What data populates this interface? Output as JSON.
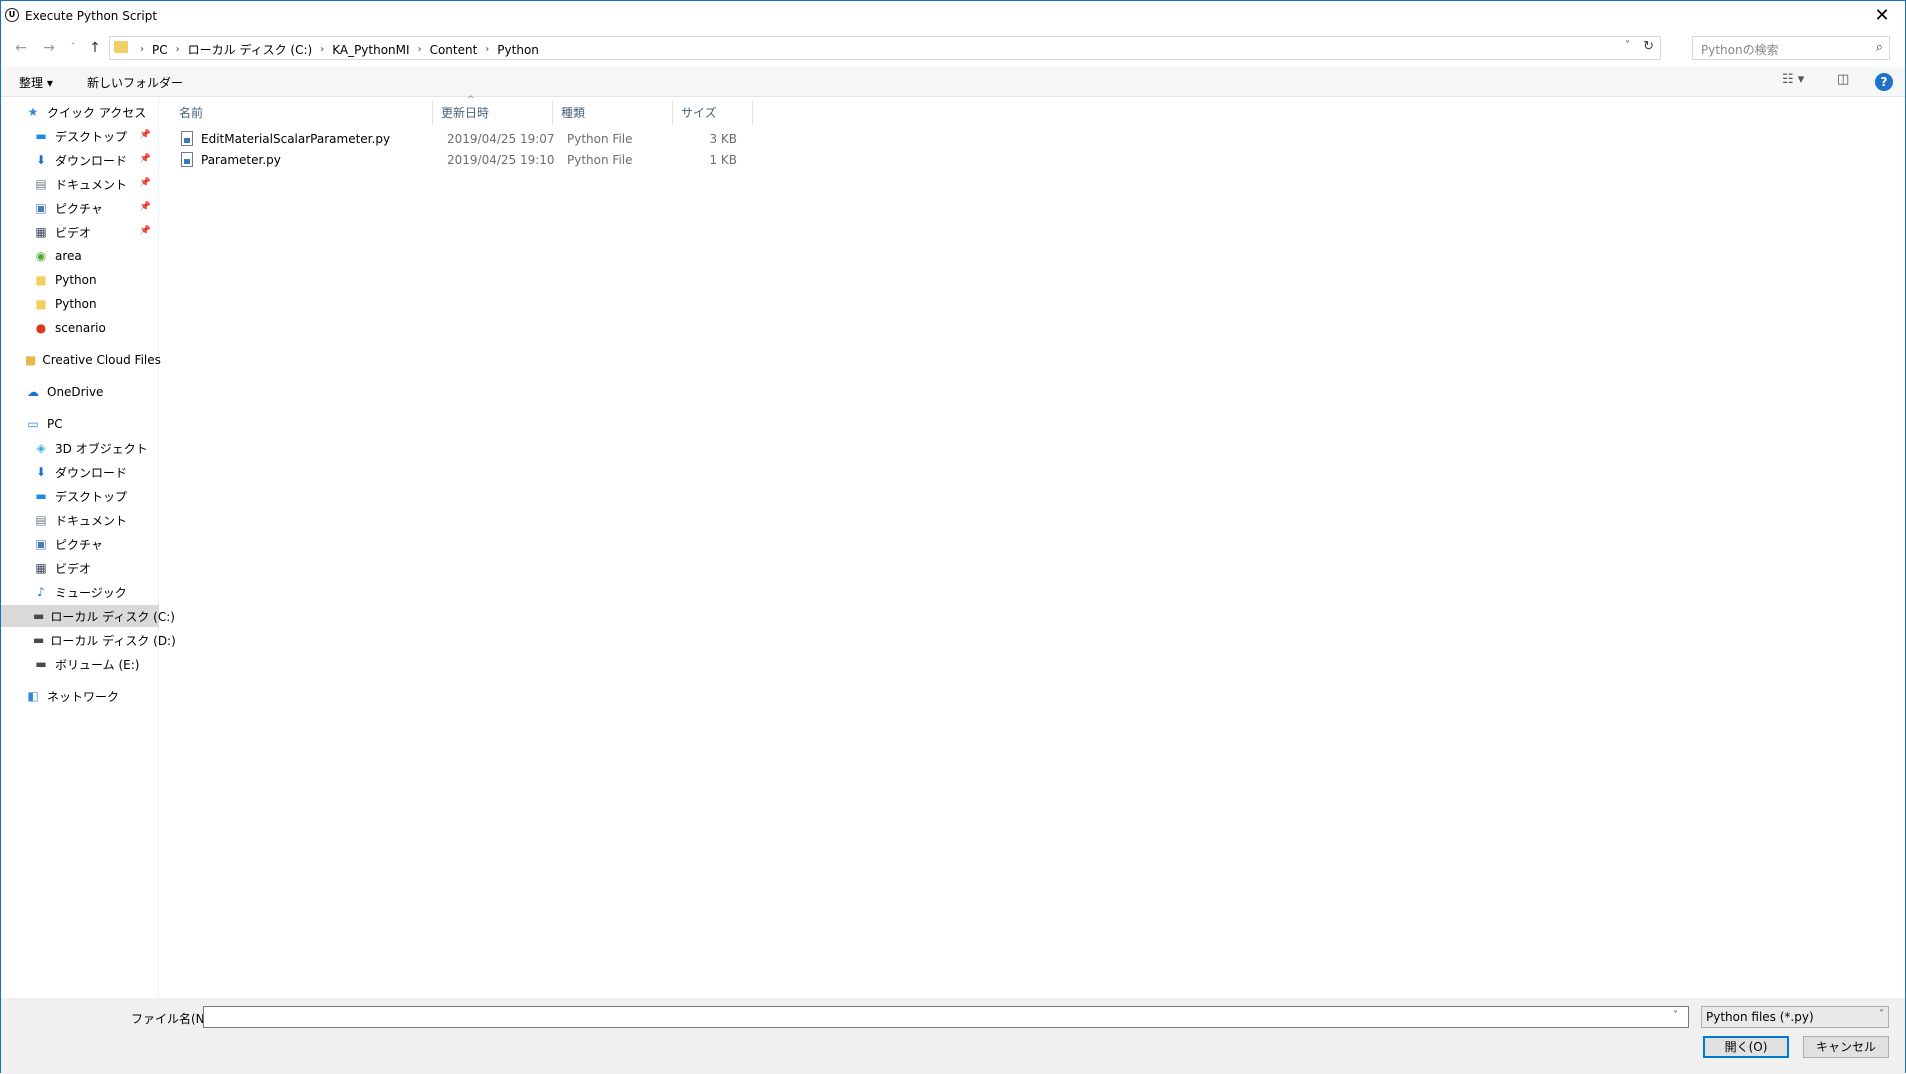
{
  "window": {
    "title": "Execute Python Script",
    "close_glyph": "✕",
    "app_icon_text": "U"
  },
  "address": {
    "crumbs": [
      "PC",
      "ローカル ディスク (C:)",
      "KA_PythonMI",
      "Content",
      "Python"
    ],
    "search_placeholder": "Pythonの検索"
  },
  "toolbar": {
    "organize": "整理 ▾",
    "new_folder": "新しいフォルダー",
    "help": "?"
  },
  "nav": {
    "items": [
      {
        "label": "クイック アクセス",
        "icon": "star-icon",
        "glyph": "★",
        "color": "#3a87d4",
        "indent": 0,
        "pinned": false,
        "top": 0
      },
      {
        "label": "デスクトップ",
        "icon": "desktop-icon",
        "glyph": "▬",
        "color": "#1e88e5",
        "indent": 1,
        "pinned": true
      },
      {
        "label": "ダウンロード",
        "icon": "download-icon",
        "glyph": "⬇",
        "color": "#1e6fc9",
        "indent": 1,
        "pinned": true
      },
      {
        "label": "ドキュメント",
        "icon": "document-icon",
        "glyph": "▤",
        "color": "#6d7b8a",
        "indent": 1,
        "pinned": true
      },
      {
        "label": "ピクチャ",
        "icon": "pictures-icon",
        "glyph": "▣",
        "color": "#4a7bb0",
        "indent": 1,
        "pinned": true
      },
      {
        "label": "ビデオ",
        "icon": "video-icon",
        "glyph": "▦",
        "color": "#3b4a5a",
        "indent": 1,
        "pinned": true
      },
      {
        "label": "area",
        "icon": "sync-folder-icon",
        "glyph": "◉",
        "color": "#5aa832",
        "indent": 1,
        "pinned": false
      },
      {
        "label": "Python",
        "icon": "folder-icon",
        "glyph": "■",
        "color": "#f2cf62",
        "indent": 1,
        "pinned": false
      },
      {
        "label": "Python",
        "icon": "folder-icon",
        "glyph": "■",
        "color": "#f2cf62",
        "indent": 1,
        "pinned": false
      },
      {
        "label": "scenario",
        "icon": "error-folder-icon",
        "glyph": "●",
        "color": "#d9381e",
        "indent": 1,
        "pinned": false
      },
      {
        "label": "Creative Cloud Files",
        "icon": "creative-cloud-icon",
        "glyph": "■",
        "color": "#e8b84a",
        "indent": 0,
        "pinned": false
      },
      {
        "label": "OneDrive",
        "icon": "onedrive-icon",
        "glyph": "☁",
        "color": "#1e73c9",
        "indent": 0,
        "pinned": false
      },
      {
        "label": "PC",
        "icon": "pc-icon",
        "glyph": "▭",
        "color": "#3a87d4",
        "indent": 0,
        "pinned": false
      },
      {
        "label": "3D オブジェクト",
        "icon": "3d-objects-icon",
        "glyph": "◈",
        "color": "#3cb0d8",
        "indent": 1,
        "pinned": false
      },
      {
        "label": "ダウンロード",
        "icon": "download-icon",
        "glyph": "⬇",
        "color": "#1e6fc9",
        "indent": 1,
        "pinned": false
      },
      {
        "label": "デスクトップ",
        "icon": "desktop-icon",
        "glyph": "▬",
        "color": "#1e88e5",
        "indent": 1,
        "pinned": false
      },
      {
        "label": "ドキュメント",
        "icon": "document-icon",
        "glyph": "▤",
        "color": "#6d7b8a",
        "indent": 1,
        "pinned": false
      },
      {
        "label": "ピクチャ",
        "icon": "pictures-icon",
        "glyph": "▣",
        "color": "#4a7bb0",
        "indent": 1,
        "pinned": false
      },
      {
        "label": "ビデオ",
        "icon": "video-icon",
        "glyph": "▦",
        "color": "#3b4a5a",
        "indent": 1,
        "pinned": false
      },
      {
        "label": "ミュージック",
        "icon": "music-icon",
        "glyph": "♪",
        "color": "#1e73c9",
        "indent": 1,
        "pinned": false
      },
      {
        "label": "ローカル ディスク (C:)",
        "icon": "drive-c-icon",
        "glyph": "▬",
        "color": "#4a4a4a",
        "indent": 1,
        "pinned": false,
        "selected": true
      },
      {
        "label": "ローカル ディスク (D:)",
        "icon": "drive-icon",
        "glyph": "▬",
        "color": "#4a4a4a",
        "indent": 1,
        "pinned": false
      },
      {
        "label": "ボリューム (E:)",
        "icon": "drive-icon",
        "glyph": "▬",
        "color": "#4a4a4a",
        "indent": 1,
        "pinned": false
      },
      {
        "label": "ネットワーク",
        "icon": "network-icon",
        "glyph": "◧",
        "color": "#3a87d4",
        "indent": 0,
        "pinned": false
      }
    ]
  },
  "files": {
    "columns": [
      "名前",
      "更新日時",
      "種類",
      "サイズ"
    ],
    "rows": [
      {
        "name": "EditMaterialScalarParameter.py",
        "date": "2019/04/25 19:07",
        "type": "Python File",
        "size": "3 KB"
      },
      {
        "name": "Parameter.py",
        "date": "2019/04/25 19:10",
        "type": "Python File",
        "size": "1 KB"
      }
    ]
  },
  "bottom": {
    "filename_label": "ファイル名(N):",
    "filename_value": "",
    "filter_value": "Python files (*.py)",
    "open_label": "開く(O)",
    "cancel_label": "キャンセル"
  }
}
